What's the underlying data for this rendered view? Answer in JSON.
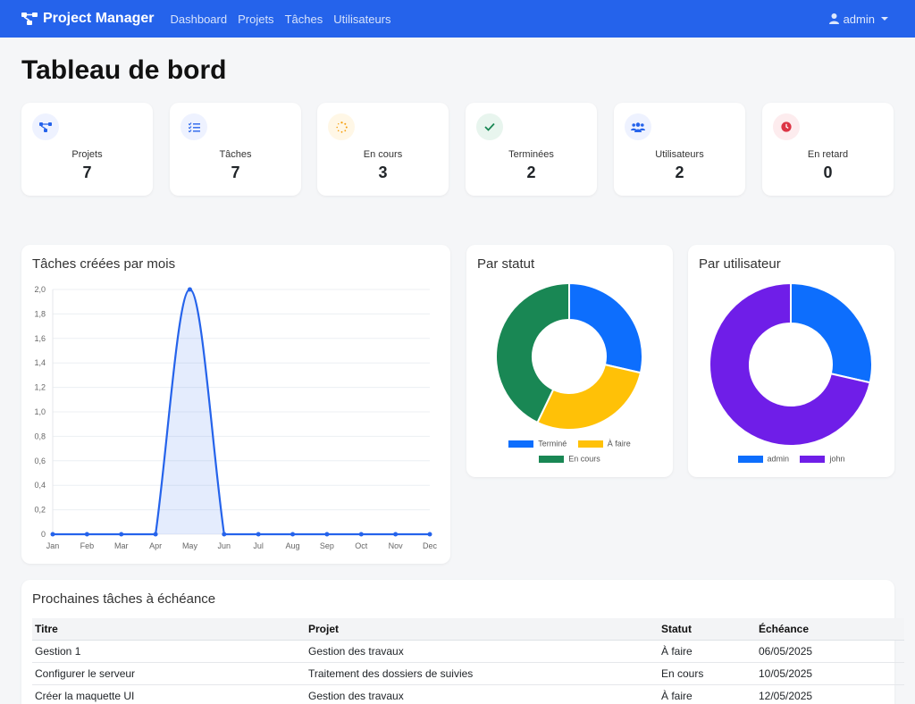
{
  "navbar": {
    "brand": "Project Manager",
    "links": [
      "Dashboard",
      "Projets",
      "Tâches",
      "Utilisateurs"
    ],
    "user": "admin",
    "color": "#2563eb"
  },
  "page": {
    "title": "Tableau de bord"
  },
  "stats": [
    {
      "label": "Projets",
      "value": "7",
      "icon": "project-diagram-icon",
      "color": "#2563eb"
    },
    {
      "label": "Tâches",
      "value": "7",
      "icon": "tasks-icon",
      "color": "#2563eb"
    },
    {
      "label": "En cours",
      "value": "3",
      "icon": "spinner-icon",
      "color": "#f59e0b"
    },
    {
      "label": "Terminées",
      "value": "2",
      "icon": "check-icon",
      "color": "#198754"
    },
    {
      "label": "Utilisateurs",
      "value": "2",
      "icon": "users-icon",
      "color": "#2563eb"
    },
    {
      "label": "En retard",
      "value": "0",
      "icon": "clock-icon",
      "color": "#dc3545"
    }
  ],
  "charts": {
    "monthly_title": "Tâches créées par mois",
    "status_title": "Par statut",
    "user_title": "Par utilisateur"
  },
  "chart_data": [
    {
      "type": "area",
      "title": "Tâches créées par mois",
      "categories": [
        "Jan",
        "Feb",
        "Mar",
        "Apr",
        "May",
        "Jun",
        "Jul",
        "Aug",
        "Sep",
        "Oct",
        "Nov",
        "Dec"
      ],
      "values": [
        0,
        0,
        0,
        0,
        2,
        0,
        0,
        0,
        0,
        0,
        0,
        0
      ],
      "yticks": [
        "0",
        "0,2",
        "0,4",
        "0,6",
        "0,8",
        "1,0",
        "1,2",
        "1,4",
        "1,6",
        "1,8",
        "2,0"
      ],
      "ylim": [
        0,
        2
      ],
      "grid": true,
      "color": "#2563eb"
    },
    {
      "type": "pie",
      "title": "Par statut",
      "labels": [
        "Terminé",
        "À faire",
        "En cours"
      ],
      "values": [
        2,
        2,
        3
      ],
      "colors": [
        "#0d6efd",
        "#ffc107",
        "#198754"
      ],
      "legend": "bottom"
    },
    {
      "type": "pie",
      "title": "Par utilisateur",
      "labels": [
        "admin",
        "john"
      ],
      "values": [
        2,
        5
      ],
      "colors": [
        "#0d6efd",
        "#6f1ee8"
      ],
      "legend": "bottom"
    }
  ],
  "upcoming": {
    "title": "Prochaines tâches à échéance",
    "headers": [
      "Titre",
      "Projet",
      "Statut",
      "Échéance"
    ],
    "rows": [
      [
        "Gestion 1",
        "Gestion des travaux",
        "À faire",
        "06/05/2025"
      ],
      [
        "Configurer le serveur",
        "Traitement des dossiers de suivies",
        "En cours",
        "10/05/2025"
      ],
      [
        "Créer la maquette UI",
        "Gestion des travaux",
        "À faire",
        "12/05/2025"
      ]
    ]
  }
}
